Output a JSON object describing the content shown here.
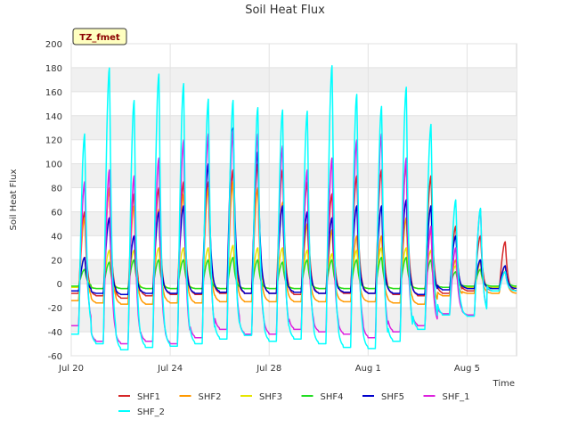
{
  "chart_data": {
    "type": "line",
    "title": "Soil Heat Flux",
    "xlabel": "Time",
    "ylabel": "Soil Heat Flux",
    "badge": "TZ_fmet",
    "x_range_days": [
      0,
      18
    ],
    "xticks": [
      {
        "day": 0,
        "label": "Jul 20"
      },
      {
        "day": 4,
        "label": "Jul 24"
      },
      {
        "day": 8,
        "label": "Jul 28"
      },
      {
        "day": 12,
        "label": "Aug 1"
      },
      {
        "day": 16,
        "label": "Aug 5"
      }
    ],
    "ylim": [
      -60,
      200
    ],
    "yticks": [
      -60,
      -40,
      -20,
      0,
      20,
      40,
      60,
      80,
      100,
      120,
      140,
      160,
      180,
      200
    ],
    "grid": true,
    "legend_position": "bottom",
    "days": [
      "Jul 20",
      "Jul 21",
      "Jul 22",
      "Jul 23",
      "Jul 24",
      "Jul 25",
      "Jul 26",
      "Jul 27",
      "Jul 28",
      "Jul 29",
      "Jul 30",
      "Jul 31",
      "Aug 1",
      "Aug 2",
      "Aug 3",
      "Aug 4",
      "Aug 5",
      "Aug 6"
    ],
    "series": [
      {
        "name": "SHF1",
        "color": "#d62728",
        "daily_max": [
          60,
          80,
          75,
          80,
          85,
          85,
          95,
          100,
          95,
          85,
          75,
          90,
          95,
          100,
          90,
          48,
          40,
          35
        ],
        "daily_min": [
          -8,
          -10,
          -12,
          -10,
          -9,
          -9,
          -8,
          -8,
          -8,
          -9,
          -8,
          -8,
          -8,
          -9,
          -10,
          -8,
          -6,
          -6
        ]
      },
      {
        "name": "SHF2",
        "color": "#ff9900",
        "daily_max": [
          55,
          80,
          65,
          62,
          75,
          80,
          85,
          80,
          68,
          50,
          45,
          40,
          40,
          55,
          45,
          20,
          18,
          15
        ],
        "daily_min": [
          -14,
          -16,
          -17,
          -17,
          -16,
          -16,
          -15,
          -15,
          -15,
          -15,
          -15,
          -15,
          -15,
          -16,
          -17,
          -10,
          -8,
          -8
        ]
      },
      {
        "name": "SHF3",
        "color": "#e6e600",
        "daily_max": [
          22,
          28,
          28,
          30,
          30,
          30,
          32,
          30,
          30,
          28,
          25,
          28,
          30,
          30,
          28,
          15,
          12,
          10
        ],
        "daily_min": [
          -3,
          -4,
          -4,
          -4,
          -4,
          -4,
          -4,
          -4,
          -4,
          -4,
          -4,
          -4,
          -4,
          -4,
          -4,
          -3,
          -3,
          -3
        ]
      },
      {
        "name": "SHF4",
        "color": "#22dd22",
        "daily_max": [
          12,
          18,
          20,
          20,
          20,
          20,
          22,
          20,
          18,
          20,
          20,
          20,
          22,
          22,
          20,
          10,
          12,
          10
        ],
        "daily_min": [
          -2,
          -4,
          -4,
          -4,
          -4,
          -4,
          -4,
          -4,
          -4,
          -4,
          -4,
          -4,
          -4,
          -4,
          -4,
          -3,
          -2,
          -2
        ]
      },
      {
        "name": "SHF5",
        "color": "#0000cc",
        "daily_max": [
          22,
          55,
          40,
          60,
          65,
          100,
          130,
          110,
          65,
          60,
          55,
          65,
          65,
          70,
          65,
          40,
          20,
          15
        ],
        "daily_min": [
          -6,
          -8,
          -9,
          -8,
          -8,
          -8,
          -7,
          -8,
          -8,
          -7,
          -8,
          -7,
          -8,
          -8,
          -9,
          -5,
          -4,
          -4
        ]
      },
      {
        "name": "SHF_1",
        "color": "#dd22dd",
        "daily_max": [
          85,
          95,
          90,
          105,
          120,
          125,
          128,
          125,
          115,
          95,
          105,
          120,
          125,
          105,
          48,
          30,
          62,
          10
        ],
        "daily_min": [
          -35,
          -48,
          -50,
          -48,
          -50,
          -45,
          -38,
          -42,
          -42,
          -38,
          -40,
          -42,
          -45,
          -40,
          -35,
          -25,
          -26,
          -6
        ]
      },
      {
        "name": "SHF_2",
        "color": "#00ffff",
        "daily_max": [
          125,
          180,
          153,
          175,
          167,
          154,
          153,
          147,
          145,
          144,
          182,
          158,
          148,
          164,
          133,
          70,
          63,
          10
        ],
        "daily_min": [
          -42,
          -50,
          -55,
          -53,
          -52,
          -50,
          -46,
          -43,
          -48,
          -46,
          -50,
          -53,
          -54,
          -48,
          -38,
          -26,
          -27,
          -6
        ]
      }
    ]
  }
}
